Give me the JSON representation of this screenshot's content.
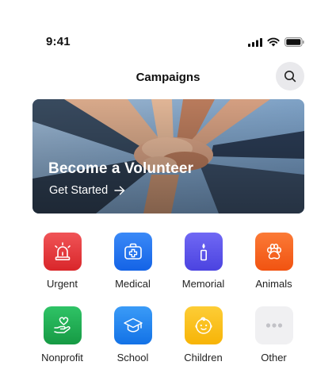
{
  "status_bar": {
    "time": "9:41"
  },
  "header": {
    "title": "Campaigns",
    "search_icon": "search-icon"
  },
  "banner": {
    "title": "Become a Volunteer",
    "cta_label": "Get Started",
    "cta_icon": "arrow-right-icon"
  },
  "categories": [
    {
      "label": "Urgent",
      "icon": "siren-icon",
      "color": "#e5383b"
    },
    {
      "label": "Medical",
      "icon": "medical-kit-icon",
      "color": "#1f73f0"
    },
    {
      "label": "Memorial",
      "icon": "candle-icon",
      "color": "#5d56ee"
    },
    {
      "label": "Animals",
      "icon": "paw-icon",
      "color": "#f9651f"
    },
    {
      "label": "Nonprofit",
      "icon": "hand-heart-icon",
      "color": "#1fae52"
    },
    {
      "label": "School",
      "icon": "graduation-cap-icon",
      "color": "#1b84f2"
    },
    {
      "label": "Children",
      "icon": "child-face-icon",
      "color": "#fbc31c"
    },
    {
      "label": "Other",
      "icon": "more-dots-icon",
      "color": "#f0f0f2"
    }
  ]
}
